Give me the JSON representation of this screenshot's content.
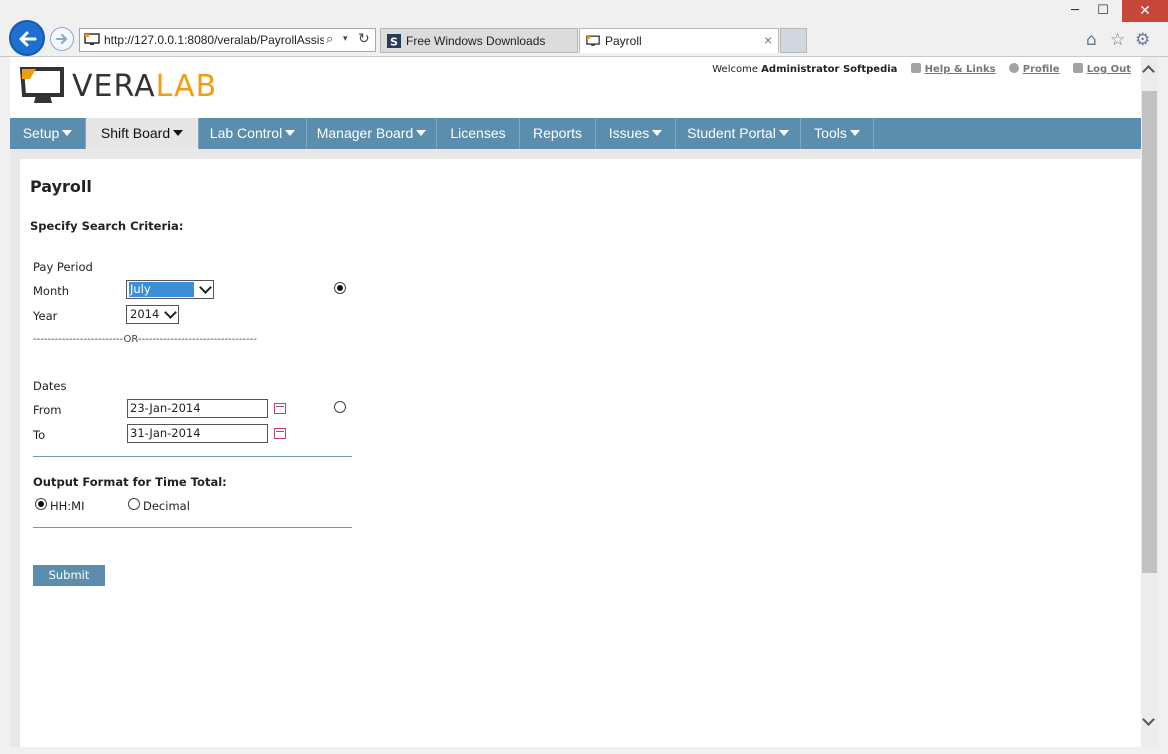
{
  "browser": {
    "address": "http://127.0.0.1:8080/veralab/PayrollAssis",
    "tabs": [
      {
        "label": "Free Windows Downloads",
        "icon": "softpedia-s-icon"
      },
      {
        "label": "Payroll",
        "icon": "veralab-monitor-icon",
        "close": "×"
      }
    ],
    "window_buttons": {
      "minimize": "─",
      "maximize": "☐",
      "close": "✕"
    },
    "tools": {
      "home": "⌂",
      "favorites": "☆",
      "settings": "⚙"
    },
    "address_icons": {
      "search": "⌕",
      "dropdown": "▾",
      "refresh": "↻"
    }
  },
  "logo": {
    "part1": "VERA",
    "part2": "LAB",
    "accent": "#f39c12"
  },
  "userbar": {
    "welcome": "Welcome",
    "user": "Administrator Softpedia",
    "help": "Help & Links",
    "profile": "Profile",
    "logout": "Log Out"
  },
  "nav": [
    {
      "label": "Setup",
      "caret": true
    },
    {
      "label": "Shift Board",
      "caret": true,
      "active": true
    },
    {
      "label": "Lab Control",
      "caret": true
    },
    {
      "label": "Manager Board",
      "caret": true
    },
    {
      "label": "Licenses",
      "caret": false
    },
    {
      "label": "Reports",
      "caret": false
    },
    {
      "label": "Issues",
      "caret": true
    },
    {
      "label": "Student Portal",
      "caret": true
    },
    {
      "label": "Tools",
      "caret": true
    }
  ],
  "form": {
    "title": "Payroll",
    "criteria_heading": "Specify Search Criteria:",
    "pay_period_label": "Pay Period",
    "month_label": "Month",
    "month_value": "July",
    "year_label": "Year",
    "year_value": "2014",
    "or_divider": "-------------------------OR---------------------------------",
    "dates_label": "Dates",
    "from_label": "From",
    "from_value": "23-Jan-2014",
    "to_label": "To",
    "to_value": "31-Jan-2014",
    "pay_period_selected": true,
    "dates_selected": false,
    "output_heading": "Output Format for Time Total:",
    "format_hhmi": "HH:MI",
    "format_decimal": "Decimal",
    "hhmi_selected": true,
    "submit_label": "Submit"
  },
  "colors": {
    "nav_bg": "#5a8eac",
    "accent_orange": "#f39c12"
  }
}
